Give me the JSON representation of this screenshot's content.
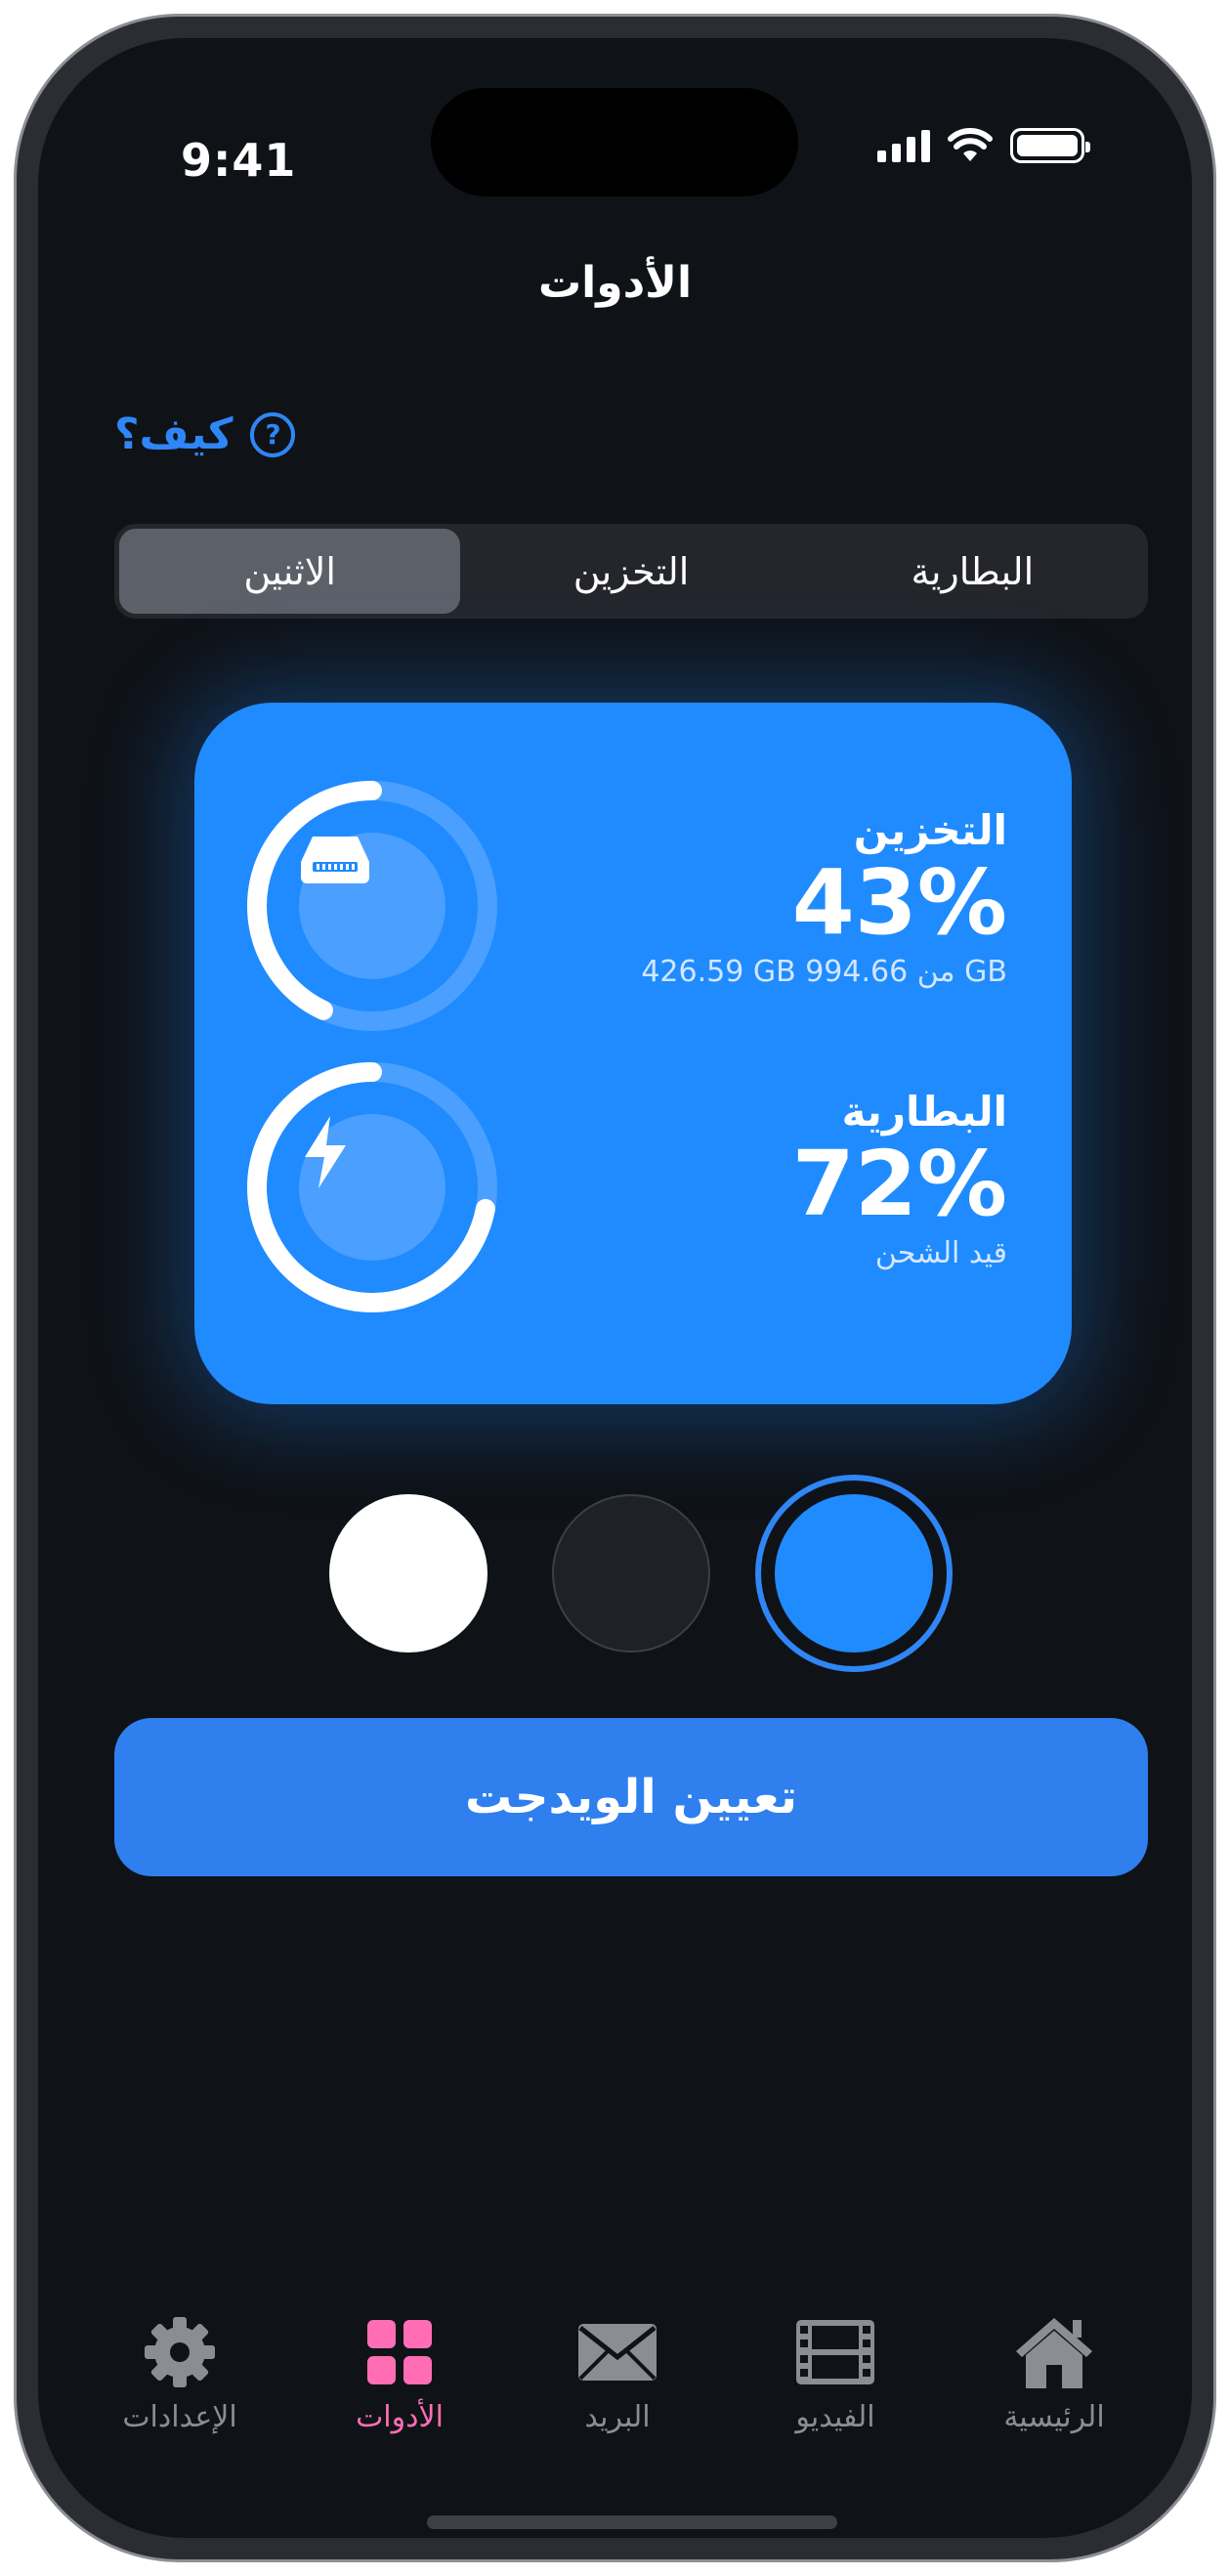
{
  "status_bar": {
    "time": "9:41"
  },
  "header": {
    "title": "الأدوات"
  },
  "help": {
    "label": "كيف؟",
    "icon": "question-circle-icon"
  },
  "segmented": {
    "items": [
      {
        "label": "البطارية",
        "active": false
      },
      {
        "label": "التخزين",
        "active": false
      },
      {
        "label": "الاثنين",
        "active": true
      }
    ]
  },
  "widget": {
    "storage": {
      "label": "التخزين",
      "percent": "43%",
      "detail": "426.59 GB من 994.66 GB",
      "fraction": 0.43,
      "icon": "drive-icon"
    },
    "battery": {
      "label": "البطارية",
      "percent": "72%",
      "detail": "قيد الشحن",
      "fraction": 0.72,
      "icon": "bolt-icon"
    },
    "color": "#1f8bff"
  },
  "color_options": [
    {
      "name": "white",
      "color": "#ffffff",
      "selected": false
    },
    {
      "name": "dark",
      "color": "#1f2128",
      "selected": false
    },
    {
      "name": "blue",
      "color": "#1f8bff",
      "selected": true
    }
  ],
  "primary_button": {
    "label": "تعيين الويدجت"
  },
  "tabbar": {
    "items": [
      {
        "label": "الإعدادات",
        "icon": "gear-icon",
        "active": false
      },
      {
        "label": "الأدوات",
        "icon": "grid-icon",
        "active": true
      },
      {
        "label": "البريد",
        "icon": "mail-icon",
        "active": false
      },
      {
        "label": "الفيديو",
        "icon": "film-icon",
        "active": false
      },
      {
        "label": "الرئيسية",
        "icon": "home-icon",
        "active": false
      }
    ],
    "active_color": "#ff6eb4"
  }
}
